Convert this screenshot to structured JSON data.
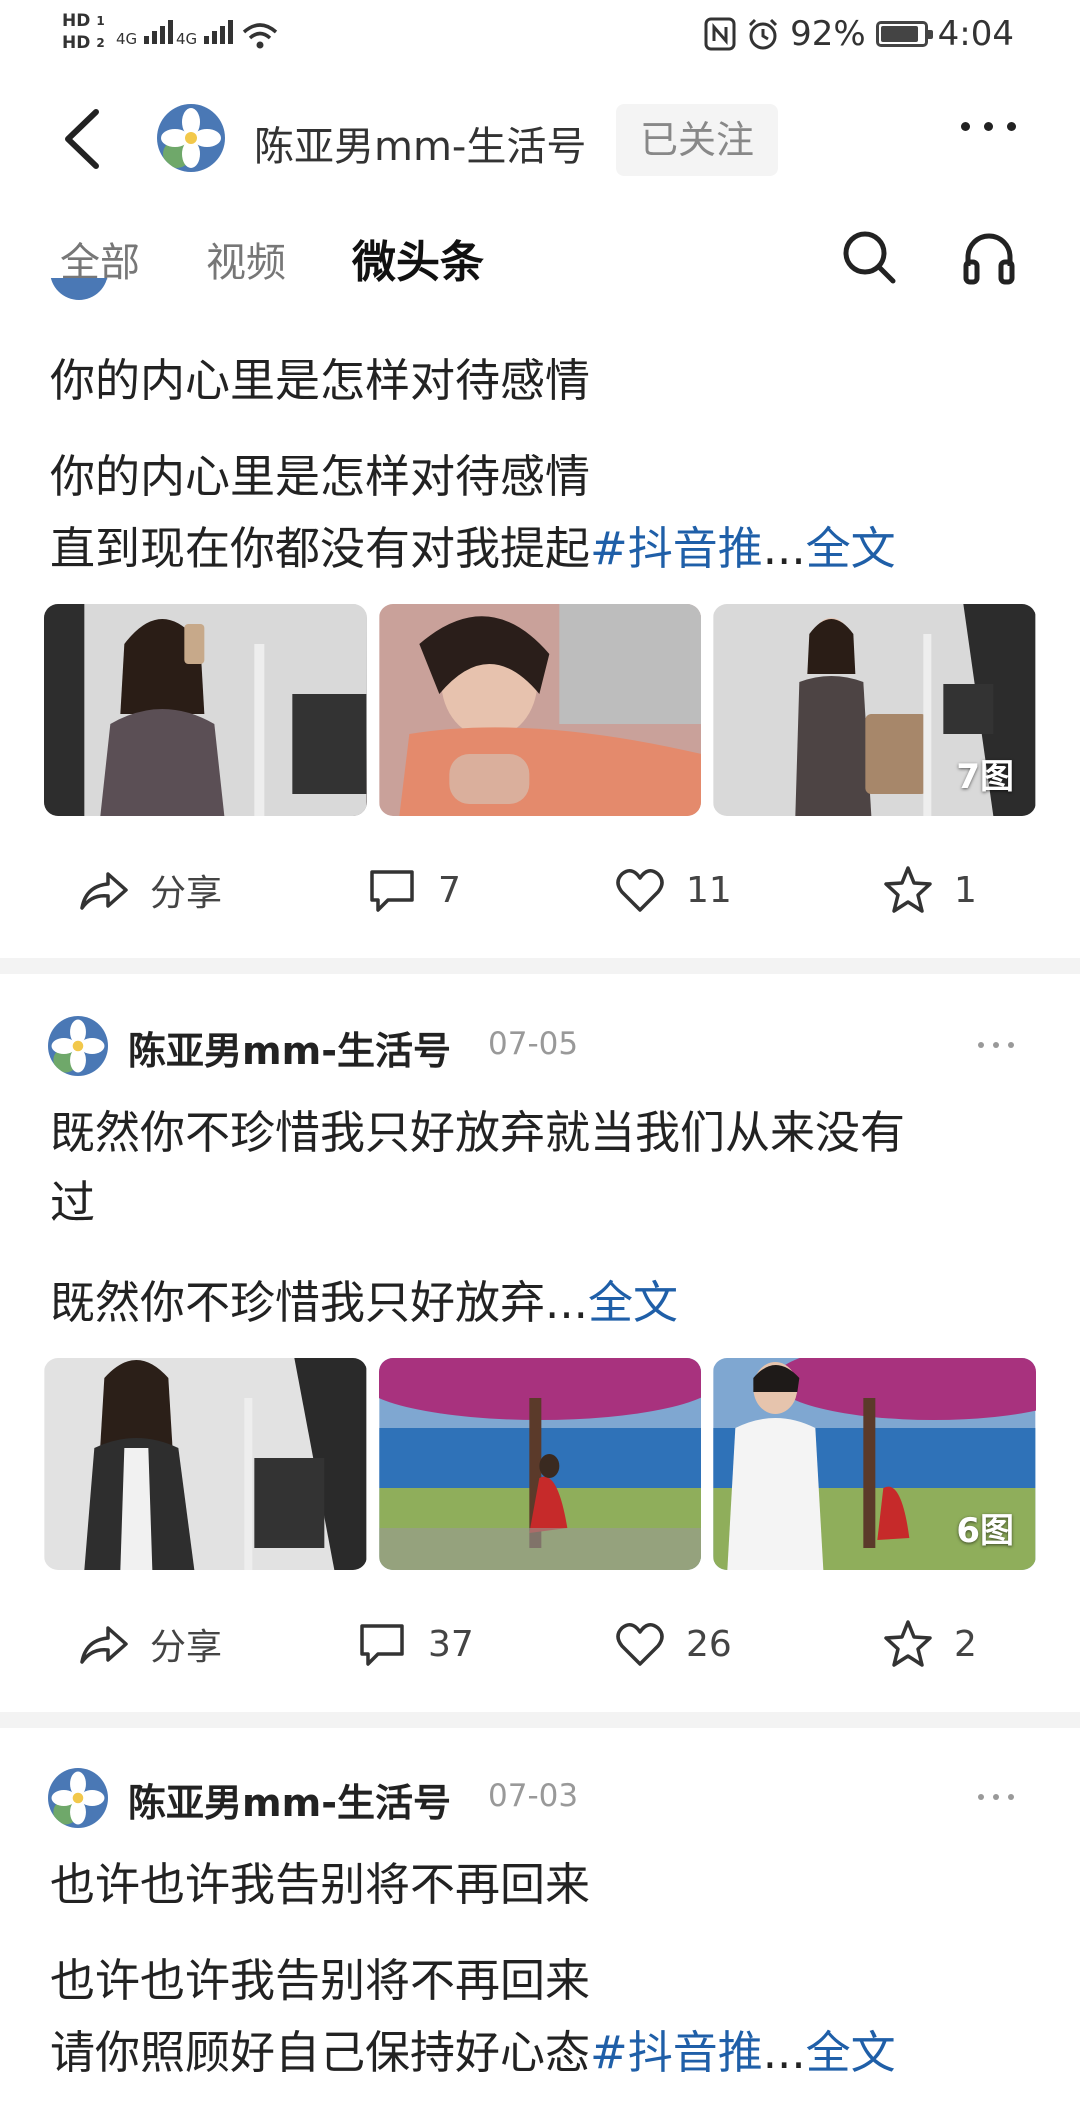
{
  "status_bar": {
    "hd1": "HD",
    "hd1_index": "1",
    "hd2": "HD",
    "hd2_index": "2",
    "net1": "4G",
    "net2": "4G",
    "battery_text": "92%",
    "battery_level": 0.92,
    "time": "4:04",
    "icons": [
      "nfc-icon",
      "alarm-icon",
      "wifi-icon",
      "battery-icon"
    ]
  },
  "header": {
    "title": "陈亚男mm-生活号",
    "follow_label": "已关注"
  },
  "tabs": [
    {
      "label": "全部",
      "active": false
    },
    {
      "label": "视频",
      "active": false
    },
    {
      "label": "微头条",
      "active": true
    }
  ],
  "posts": [
    {
      "title": "你的内心里是怎样对待感情",
      "body_line1": "你的内心里是怎样对待感情",
      "body_line2": "直到现在你都没有对我提起",
      "tag": "#抖音推",
      "ellipsis": "...",
      "fulltext": "全文",
      "image_count": "7图",
      "share_label": "分享",
      "comments": "7",
      "likes": "11",
      "favorites": "1"
    },
    {
      "author": "陈亚男mm-生活号",
      "date": "07-05",
      "title_line1": "既然你不珍惜我只好放弃就当我们从来没有",
      "title_line2": "过",
      "body_line1": "既然你不珍惜我只好放弃",
      "ellipsis": "...",
      "fulltext": "全文",
      "image_count": "6图",
      "share_label": "分享",
      "comments": "37",
      "likes": "26",
      "favorites": "2"
    },
    {
      "author": "陈亚男mm-生活号",
      "date": "07-03",
      "title": "也许也许我告别将不再回来",
      "body_line1": "也许也许我告别将不再回来",
      "body_line2": "请你照顾好自己保持好心态",
      "tag": "#抖音推",
      "ellipsis": "...",
      "fulltext": "全文"
    }
  ],
  "colors": {
    "link": "#1f5fa8",
    "divider": "#f3f3f3",
    "follow_bg": "#f4f4f4"
  }
}
